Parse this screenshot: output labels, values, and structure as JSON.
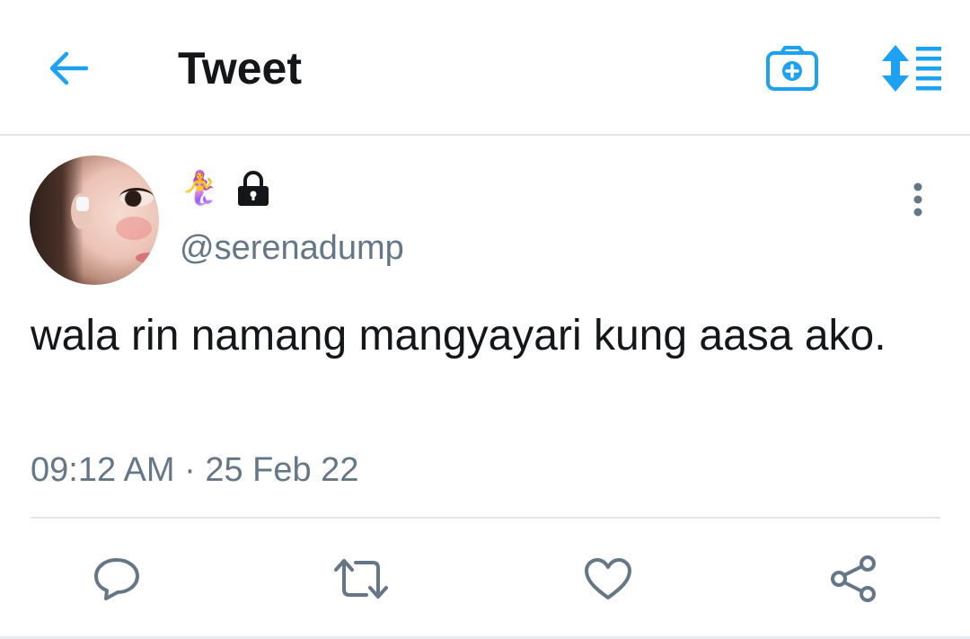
{
  "header": {
    "title": "Tweet",
    "back_icon": "arrow-left-icon",
    "camera_icon": "camera-add-icon",
    "sort_icon": "sort-list-icon"
  },
  "tweet": {
    "display_name_emoji": "🧜‍♀️",
    "protected_icon": "lock-icon",
    "handle": "@serenadump",
    "text": "wala rin namang mangyayari kung aasa ako.",
    "timestamp": "09:12 AM · 25 Feb 22",
    "more_icon": "more-vertical-icon"
  },
  "actions": [
    {
      "icon": "reply-icon"
    },
    {
      "icon": "retweet-icon"
    },
    {
      "icon": "like-icon"
    },
    {
      "icon": "share-icon"
    }
  ],
  "colors": {
    "accent": "#1da1f2",
    "text_primary": "#14171a",
    "text_secondary": "#657786",
    "icon_gray": "#657786",
    "divider": "#e1e6ea"
  }
}
